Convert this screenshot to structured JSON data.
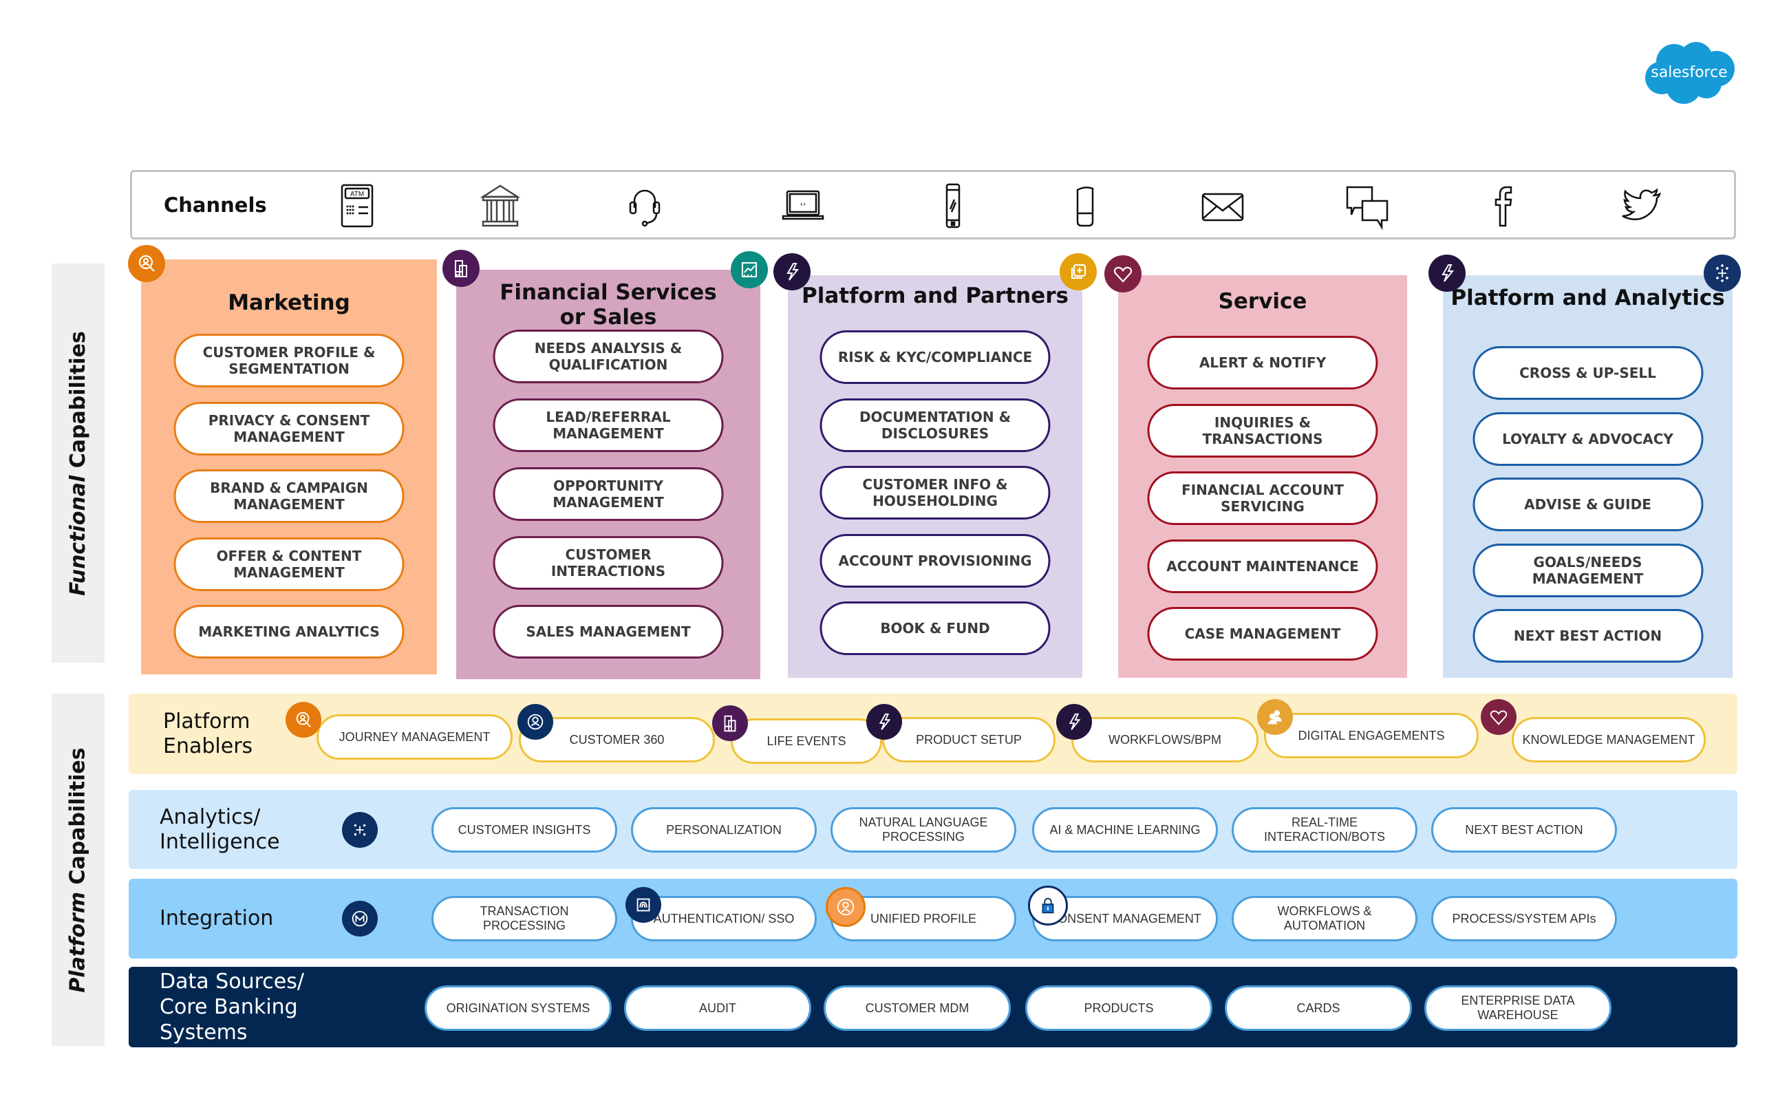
{
  "logo": {
    "text": "salesforce",
    "color": "#169bd7"
  },
  "channels": {
    "title": "Channels",
    "icons": [
      {
        "name": "atm-icon",
        "label": "ATM"
      },
      {
        "name": "bank-branch-icon"
      },
      {
        "name": "headset-icon"
      },
      {
        "name": "laptop-code-icon"
      },
      {
        "name": "mobile-phone-icon"
      },
      {
        "name": "smart-speaker-icon"
      },
      {
        "name": "email-icon"
      },
      {
        "name": "chat-icon"
      },
      {
        "name": "facebook-icon"
      },
      {
        "name": "twitter-icon"
      }
    ]
  },
  "functional": {
    "label_italic": "Functional",
    "label_rest": " Capabilities",
    "columns": [
      {
        "title": "Marketing",
        "bg": "#fdba91",
        "border": "#e87e16",
        "items": [
          "CUSTOMER PROFILE & SEGMENTATION",
          "PRIVACY & CONSENT MANAGEMENT",
          "BRAND & CAMPAIGN MANAGEMENT",
          "OFFER & CONTENT MANAGEMENT",
          "MARKETING ANALYTICS"
        ]
      },
      {
        "title": "Financial Services or Sales",
        "bg": "#d5a5c0",
        "border": "#6b1e4c",
        "items": [
          "NEEDS  ANALYSIS & QUALIFICATION",
          "LEAD/REFERRAL MANAGEMENT",
          "OPPORTUNITY MANAGEMENT",
          "CUSTOMER INTERACTIONS",
          "SALES MANAGEMENT"
        ]
      },
      {
        "title": "Platform and Partners",
        "bg": "#dcd3ea",
        "border": "#2e1a6b",
        "items": [
          "RISK & KYC/COMPLIANCE",
          "DOCUMENTATION & DISCLOSURES",
          "CUSTOMER INFO & HOUSEHOLDING",
          "ACCOUNT PROVISIONING",
          "BOOK & FUND"
        ]
      },
      {
        "title": "Service",
        "bg": "#efbcc6",
        "border": "#a20f1e",
        "items": [
          "ALERT & NOTIFY",
          "INQUIRIES & TRANSACTIONS",
          "FINANCIAL ACCOUNT SERVICING",
          "ACCOUNT MAINTENANCE",
          "CASE MANAGEMENT"
        ]
      },
      {
        "title": "Platform and Analytics",
        "bg": "#cfe1f3",
        "border": "#1a5ea8",
        "items": [
          "CROSS & UP-SELL",
          "LOYALTY & ADVOCACY",
          "ADVISE & GUIDE",
          "GOALS/NEEDS MANAGEMENT",
          "NEXT BEST ACTION"
        ]
      }
    ]
  },
  "platform": {
    "label_italic": "Platform",
    "label_rest": " Capabilities",
    "enablers": {
      "title": "Platform Enablers",
      "bg": "#fdf0c9",
      "border": "#f0c23a",
      "items": [
        "JOURNEY MANAGEMENT",
        "CUSTOMER 360",
        "LIFE EVENTS",
        "PRODUCT SETUP",
        "WORKFLOWS/BPM",
        "DIGITAL ENGAGEMENTS",
        "KNOWLEDGE MANAGEMENT"
      ]
    },
    "analytics": {
      "title": "Analytics/ Intelligence",
      "bg": "#cfe8fc",
      "border": "#4a9fdc",
      "items": [
        "CUSTOMER INSIGHTS",
        "PERSONALIZATION",
        "NATURAL LANGUAGE PROCESSING",
        "AI & MACHINE LEARNING",
        "REAL-TIME INTERACTION/BOTS",
        "NEXT BEST ACTION"
      ]
    },
    "integration": {
      "title": "Integration",
      "bg": "#8fcffb",
      "border": "#4a9fdc",
      "items": [
        "TRANSACTION PROCESSING",
        "AUTHENTICATION/ SSO",
        "UNIFIED PROFILE",
        "CONSENT MANAGEMENT",
        "WORKFLOWS & AUTOMATION",
        "PROCESS/SYSTEM APIs"
      ]
    },
    "data_sources": {
      "title": "Data Sources/ Core Banking Systems",
      "bg": "#042751",
      "border": "#4a9fdc",
      "items": [
        "ORIGINATION SYSTEMS",
        "AUDIT",
        "CUSTOMER MDM",
        "PRODUCTS",
        "CARDS",
        "ENTERPRISE DATA WAREHOUSE"
      ]
    }
  }
}
